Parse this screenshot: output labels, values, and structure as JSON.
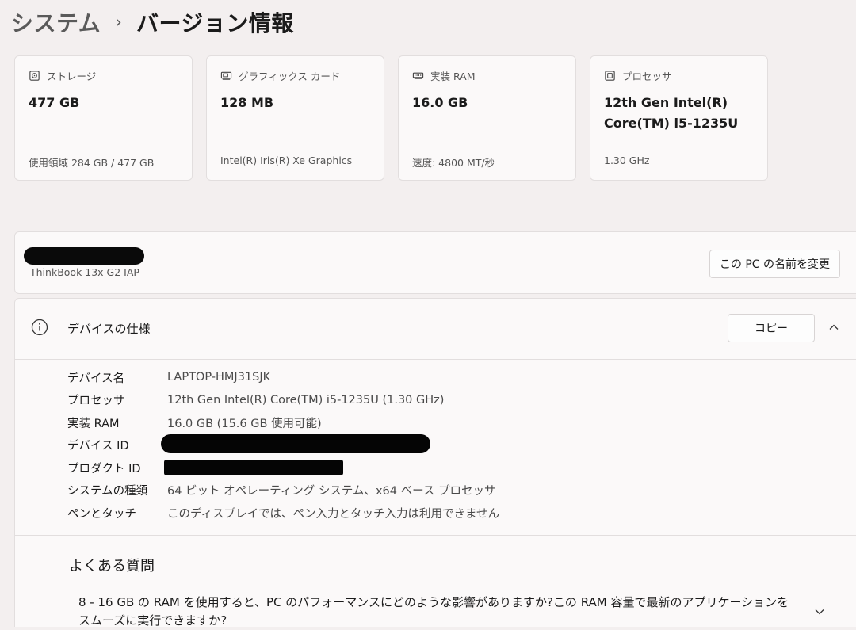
{
  "breadcrumb": {
    "parent": "システム",
    "separator": "›",
    "current": "バージョン情報"
  },
  "cards": [
    {
      "icon": "storage-icon",
      "label": "ストレージ",
      "value": "477 GB",
      "sub": "使用領域 284 GB / 477 GB"
    },
    {
      "icon": "graphics-card-icon",
      "label": "グラフィックス カード",
      "value": "128 MB",
      "sub": "Intel(R) Iris(R) Xe Graphics"
    },
    {
      "icon": "memory-icon",
      "label": "実装 RAM",
      "value": "16.0 GB",
      "sub": "速度: 4800 MT/秒"
    },
    {
      "icon": "processor-icon",
      "label": "プロセッサ",
      "value": "12th Gen Intel(R) Core(TM) i5-1235U",
      "sub": "1.30 GHz"
    }
  ],
  "device": {
    "model": "ThinkBook 13x G2 IAP",
    "rename_label": "この PC の名前を変更"
  },
  "specs": {
    "title": "デバイスの仕様",
    "copy_label": "コピー",
    "rows": [
      {
        "key": "デバイス名",
        "value": "LAPTOP-HMJ31SJK"
      },
      {
        "key": "プロセッサ",
        "value": "12th Gen Intel(R) Core(TM) i5-1235U (1.30 GHz)"
      },
      {
        "key": "実装 RAM",
        "value": "16.0 GB (15.6 GB 使用可能)"
      },
      {
        "key": "デバイス ID",
        "value": ""
      },
      {
        "key": "プロダクト ID",
        "value": ""
      },
      {
        "key": "システムの種類",
        "value": "64 ビット オペレーティング システム、x64 ベース プロセッサ"
      },
      {
        "key": "ペンとタッチ",
        "value": "このディスプレイでは、ペン入力とタッチ入力は利用できません"
      }
    ]
  },
  "faq": {
    "title": "よくある質問",
    "question": "8 - 16 GB の RAM を使用すると、PC のパフォーマンスにどのような影響がありますか?この RAM 容量で最新のアプリケーションをスムーズに実行できますか?"
  }
}
